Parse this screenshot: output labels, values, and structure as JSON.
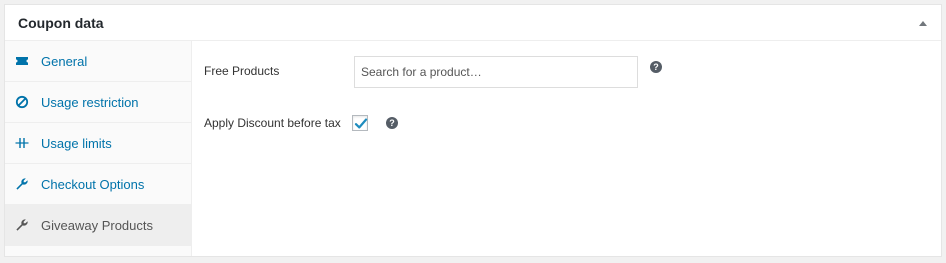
{
  "panel": {
    "title": "Coupon data"
  },
  "tabs": [
    {
      "label": "General",
      "icon": "ticket-icon"
    },
    {
      "label": "Usage restriction",
      "icon": "block-icon"
    },
    {
      "label": "Usage limits",
      "icon": "limits-icon"
    },
    {
      "label": "Checkout Options",
      "icon": "wrench-icon"
    },
    {
      "label": "Giveaway Products",
      "icon": "wrench-icon",
      "active": true
    }
  ],
  "fields": {
    "free_products": {
      "label": "Free Products",
      "placeholder": "Search for a product…",
      "value": ""
    },
    "apply_discount": {
      "label": "Apply Discount before tax",
      "checked": true
    },
    "help_glyph": "?"
  },
  "colors": {
    "link": "#0073aa",
    "active_tab_bg": "#eeeeee",
    "checkmark": "#1e8cbe"
  }
}
